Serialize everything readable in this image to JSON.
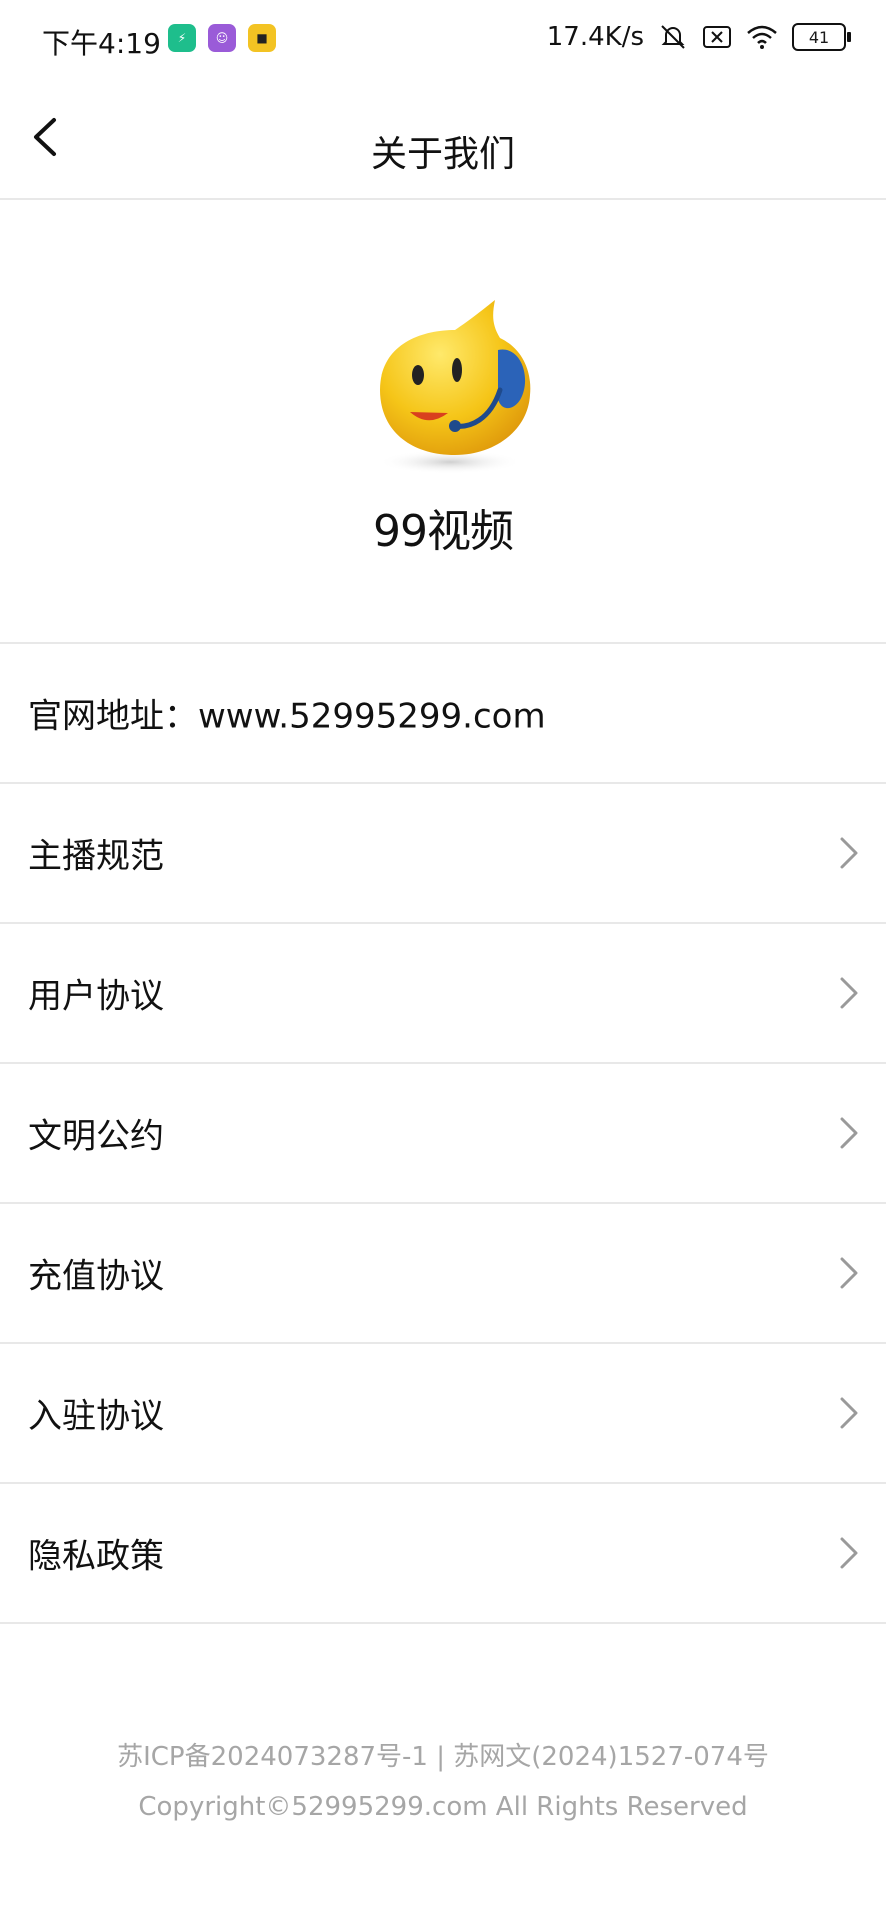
{
  "status_bar": {
    "time": "下午4:19",
    "network_speed": "17.4K/s",
    "battery_level": "41",
    "app_icons": [
      "shield-app-icon",
      "avatar-app-icon",
      "shop-app-icon"
    ]
  },
  "header": {
    "title": "关于我们",
    "back_icon": "chevron-left-icon"
  },
  "app": {
    "name": "99视频",
    "logo_icon": "smiley-headset-logo"
  },
  "website_row": {
    "label": "官网地址：www.52995299.com"
  },
  "menu": [
    {
      "label": "主播规范"
    },
    {
      "label": "用户协议"
    },
    {
      "label": "文明公约"
    },
    {
      "label": "充值协议"
    },
    {
      "label": "入驻协议"
    },
    {
      "label": "隐私政策"
    }
  ],
  "footer": {
    "icp": "苏ICP备2024073287号-1 | 苏网文(2024)1527-074号",
    "copyright": "Copyright©52995299.com All Rights Reserved"
  },
  "colors": {
    "divider": "#e8e8e8",
    "footer_text": "#a6a6a6",
    "chevron": "#9a9a9a",
    "logo_yellow": "#f5c518",
    "logo_blue": "#2b63b8"
  }
}
